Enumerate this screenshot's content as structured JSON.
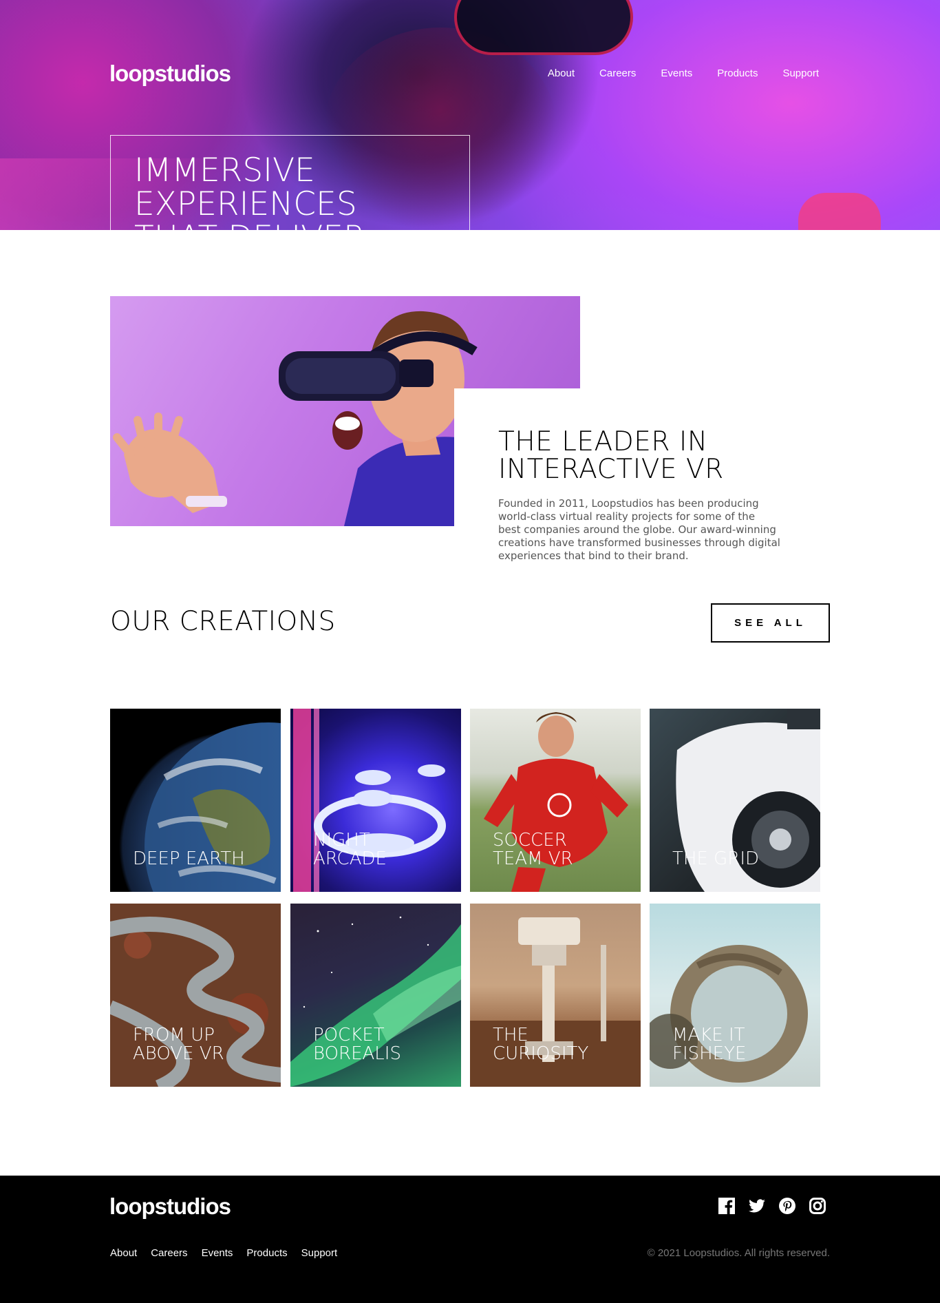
{
  "brand": {
    "logo": "loopstudios"
  },
  "nav": [
    "About",
    "Careers",
    "Events",
    "Products",
    "Support"
  ],
  "hero": {
    "headline": "IMMERSIVE EXPERIENCES THAT DELIVER"
  },
  "intro": {
    "title": "THE LEADER IN INTERACTIVE VR",
    "text": "Founded in 2011, Loopstudios has been producing world-class virtual reality projects for some of the best companies around the globe. Our award-winning creations have transformed businesses through digital experiences that bind to their brand."
  },
  "creations": {
    "title": "OUR CREATIONS",
    "see_all": "SEE ALL",
    "items": [
      {
        "title": "DEEP EARTH"
      },
      {
        "title": "NIGHT ARCADE"
      },
      {
        "title": "SOCCER TEAM VR"
      },
      {
        "title": "THE GRID"
      },
      {
        "title": "FROM UP ABOVE VR"
      },
      {
        "title": "POCKET BOREALIS"
      },
      {
        "title": "THE CURIOSITY"
      },
      {
        "title": "MAKE IT FISHEYE"
      }
    ]
  },
  "footer": {
    "logo": "loopstudios",
    "nav": [
      "About",
      "Careers",
      "Events",
      "Products",
      "Support"
    ],
    "copyright": "© 2021 Loopstudios. All rights reserved.",
    "socials": [
      "facebook-icon",
      "twitter-icon",
      "pinterest-icon",
      "instagram-icon"
    ]
  },
  "colors": {
    "footer_bg": "#000000",
    "accent": "#ffffff",
    "muted": "#777777"
  }
}
